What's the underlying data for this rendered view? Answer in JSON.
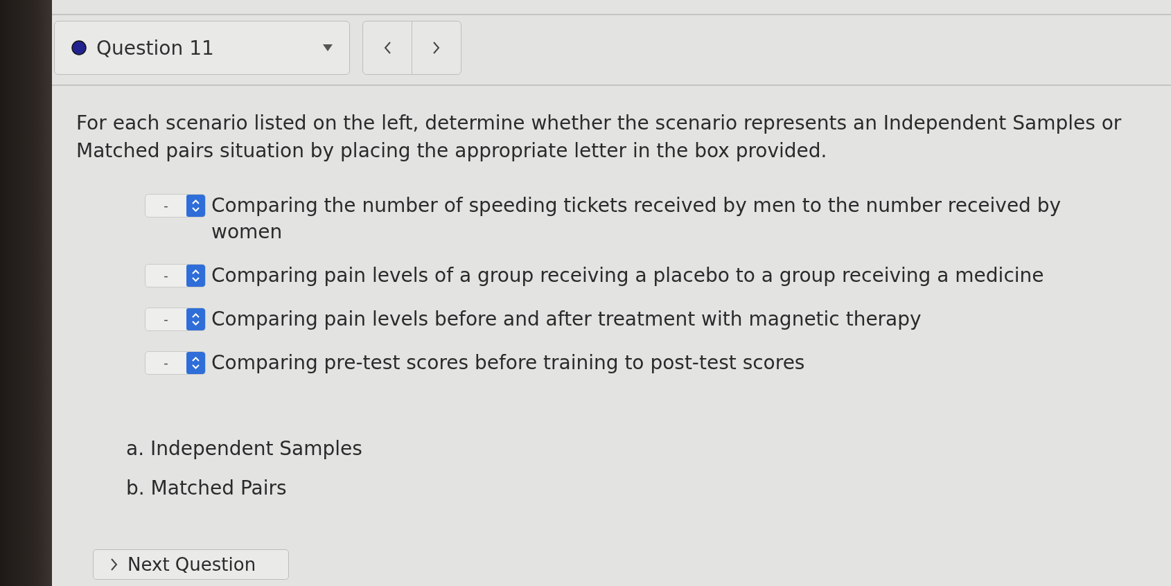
{
  "question_selector": {
    "label": "Question 11"
  },
  "prompt": "For each scenario listed on the left, determine whether the scenario represents an Independent Samples or Matched pairs situation by placing the appropriate letter in the box provided.",
  "scenarios": [
    {
      "value": "-",
      "text": "Comparing the number of speeding tickets received by men to the number received by women"
    },
    {
      "value": "-",
      "text": "Comparing pain levels of a group receiving a placebo to a group receiving a medicine"
    },
    {
      "value": "-",
      "text": "Comparing pain levels before and after treatment with magnetic therapy"
    },
    {
      "value": "-",
      "text": "Comparing pre-test scores before training to post-test scores"
    }
  ],
  "answer_key": [
    "a. Independent Samples",
    "b. Matched Pairs"
  ],
  "next_button": {
    "label": "Next Question"
  }
}
